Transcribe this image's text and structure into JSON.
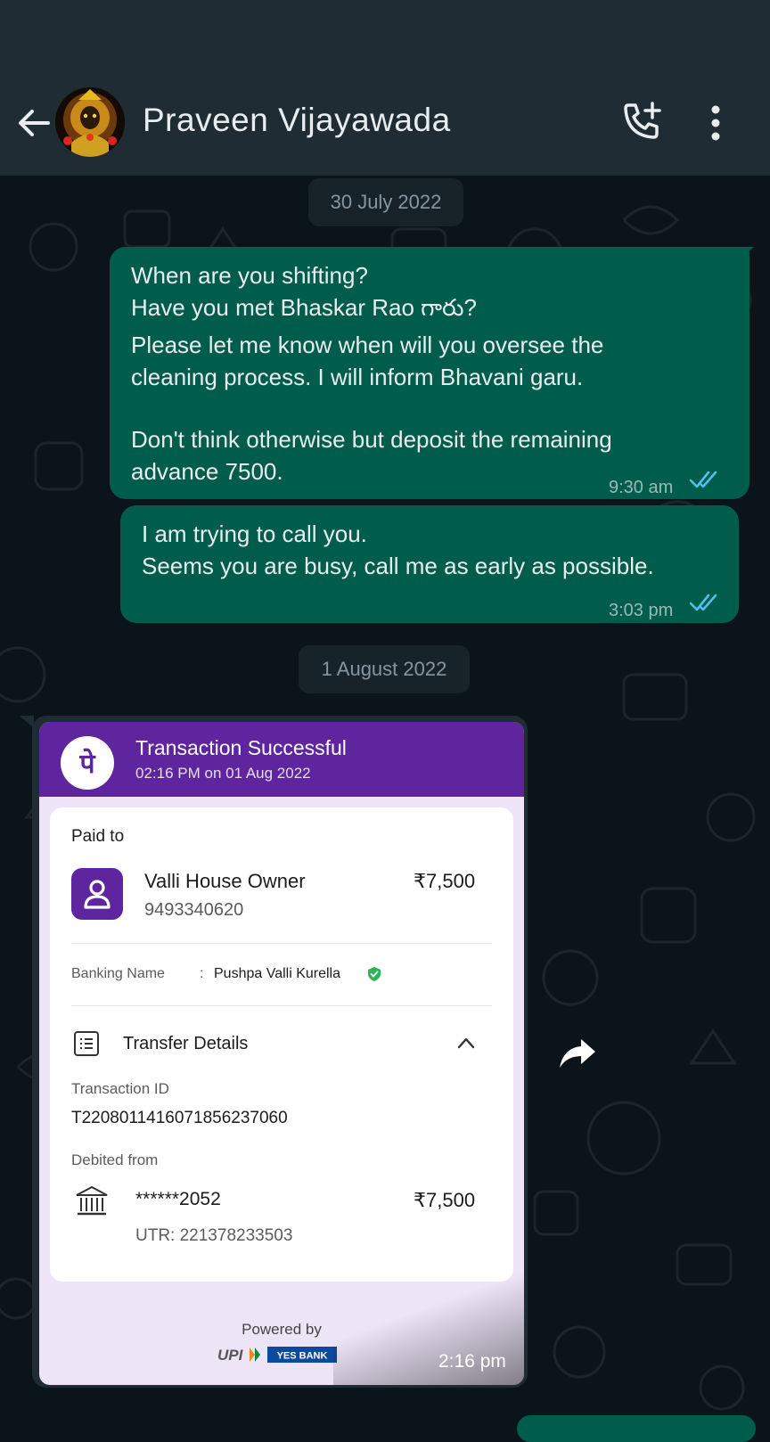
{
  "header": {
    "contact_name": "Praveen Vijayawada",
    "icons": [
      "back-arrow-icon",
      "avatar",
      "add-call-icon",
      "more-vert-icon"
    ]
  },
  "messages": {
    "date1": "30 July 2022",
    "m1_lines": [
      "When are you shifting?",
      "Have you met Bhaskar Rao గారు?",
      "Please let me know when will you oversee the",
      "cleaning process. I will inform Bhavani garu.",
      "Don't think otherwise but deposit the remaining",
      "advance 7500."
    ],
    "m1_time": "9:30 am",
    "m2_lines": [
      "I am trying to call you.",
      "Seems you are busy, call me as early as possible."
    ],
    "m2_time": "3:03 pm",
    "date2": "1 August 2022",
    "m3_time": "2:16 pm"
  },
  "receipt": {
    "title": "Transaction Successful",
    "datetime": "02:16 PM on 01 Aug 2022",
    "paid_to_label": "Paid to",
    "payee_name": "Valli House Owner",
    "payee_phone": "9493340620",
    "amount": "₹7,500",
    "banking_name_label": "Banking Name",
    "banking_name_sep": ":",
    "banking_name_value": "Pushpa Valli  Kurella",
    "transfer_details_label": "Transfer Details",
    "txn_id_label": "Transaction ID",
    "txn_id": "T2208011416071856237060",
    "debited_from_label": "Debited from",
    "account": "******2052",
    "debit_amount": "₹7,500",
    "utr": "UTR: 221378233503",
    "powered_by": "Powered by",
    "upi_text": "UPI",
    "bank_text": "YES BANK",
    "colors": {
      "phonepe_purple": "#5f259f",
      "outgoing_bubble": "#005c4b",
      "read_tick": "#53bdeb"
    }
  }
}
